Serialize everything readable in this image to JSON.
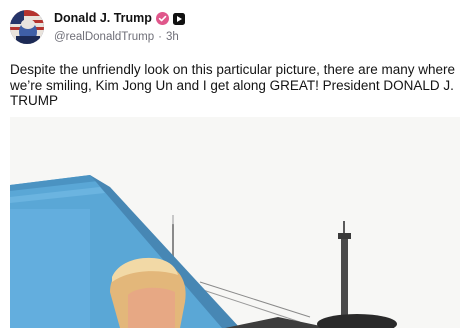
{
  "post": {
    "display_name": "Donald J. Trump",
    "handle": "@realDonaldTrump",
    "separator": "·",
    "time_ago": "3h",
    "text": "Despite the unfriendly look on this particular picture, there are many where we’re smiling, Kim Jong Un and I get along GREAT! President DONALD J. TRUMP"
  },
  "icons": {
    "verified": "verified-badge-icon",
    "source": "source-badge-icon"
  },
  "colors": {
    "verified_badge": "#e0578b",
    "source_badge": "#111111",
    "meta_text": "#6f6f78",
    "building_blue": "#5aa7d6"
  }
}
